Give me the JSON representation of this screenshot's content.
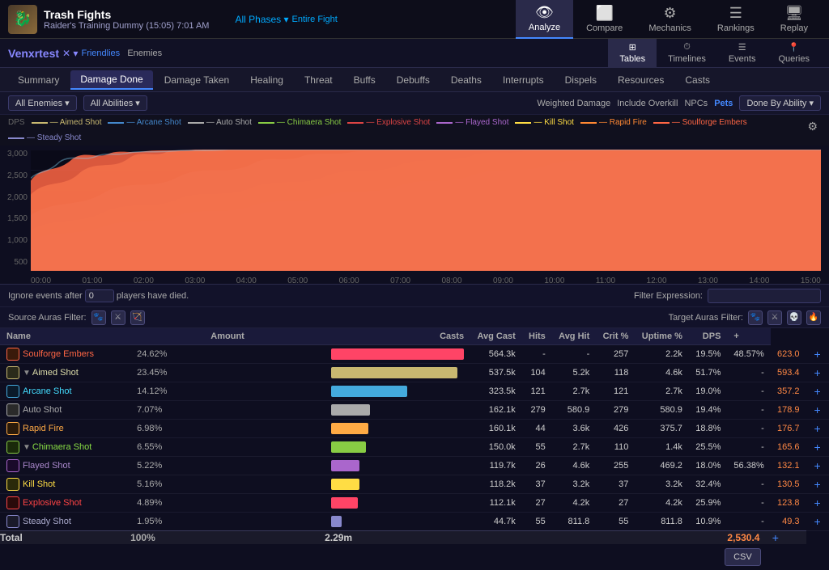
{
  "topNav": {
    "bossIcon": "🐉",
    "bossName": "Trash Fights",
    "bossSub": "Raider's Training Dummy (15:05)  7:01 AM",
    "phasesBtn": "All Phases ▾",
    "entireFight": "Entire Fight",
    "navItems": [
      {
        "label": "Analyze",
        "icon": "👁",
        "active": true
      },
      {
        "label": "Compare",
        "icon": "⬛",
        "active": false
      },
      {
        "label": "Mechanics",
        "icon": "⚙",
        "active": false
      },
      {
        "label": "Rankings",
        "icon": "≡",
        "active": false
      },
      {
        "label": "Replay",
        "icon": "🖥",
        "active": false
      }
    ]
  },
  "secondNav": {
    "playerName": "Venxrtest",
    "playerBadge": "✕",
    "friendlies": "Friendlies",
    "enemies": "Enemies",
    "tabs": [
      {
        "label": "Tables",
        "icon": "⊞",
        "active": true
      },
      {
        "label": "Timelines",
        "icon": "⏱",
        "active": false
      },
      {
        "label": "Events",
        "icon": "☰",
        "active": false
      },
      {
        "label": "Queries",
        "icon": "📍",
        "active": false
      }
    ]
  },
  "tabs": [
    {
      "label": "Summary",
      "active": false
    },
    {
      "label": "Damage Done",
      "active": true
    },
    {
      "label": "Damage Taken",
      "active": false
    },
    {
      "label": "Healing",
      "active": false
    },
    {
      "label": "Threat",
      "active": false
    },
    {
      "label": "Buffs",
      "active": false
    },
    {
      "label": "Debuffs",
      "active": false
    },
    {
      "label": "Deaths",
      "active": false
    },
    {
      "label": "Interrupts",
      "active": false
    },
    {
      "label": "Dispels",
      "active": false
    },
    {
      "label": "Resources",
      "active": false
    },
    {
      "label": "Casts",
      "active": false
    }
  ],
  "filterBar": {
    "enemies": "All Enemies ▾",
    "abilities": "All Abilities ▾",
    "weightedDamage": "Weighted Damage",
    "includeOverkill": "Include Overkill",
    "npcs": "NPCs",
    "pets": "Pets",
    "doneBy": "Done By Ability ▾"
  },
  "legend": [
    {
      "label": "Aimed Shot",
      "color": "#c8b870"
    },
    {
      "label": "Arcane Shot",
      "color": "#4488cc"
    },
    {
      "label": "Auto Shot",
      "color": "#aaaaaa"
    },
    {
      "label": "Chimaera Shot",
      "color": "#88cc44"
    },
    {
      "label": "Explosive Shot",
      "color": "#dd4444"
    },
    {
      "label": "Flayed Shot",
      "color": "#aa66cc"
    },
    {
      "label": "Kill Shot",
      "color": "#ffdd44"
    },
    {
      "label": "Rapid Fire",
      "color": "#ff8833"
    },
    {
      "label": "Soulforge Embers",
      "color": "#ff6644"
    },
    {
      "label": "Steady Shot",
      "color": "#8888cc"
    }
  ],
  "chart": {
    "yLabels": [
      "3,000",
      "2,500",
      "2,000",
      "1,500",
      "1,000",
      "500"
    ],
    "xLabels": [
      "00:00",
      "01:00",
      "02:00",
      "03:00",
      "04:00",
      "05:00",
      "06:00",
      "07:00",
      "08:00",
      "09:00",
      "10:00",
      "11:00",
      "12:00",
      "13:00",
      "14:00",
      "15:00"
    ],
    "yAxisLabel": "DPS"
  },
  "controls": {
    "ignoreText": "Ignore events after",
    "playersText": "players have died.",
    "filterLabel": "Filter Expression:",
    "filterPlaceholder": ""
  },
  "auras": {
    "sourceLabel": "Source Auras Filter:",
    "targetLabel": "Target Auras Filter:"
  },
  "tableHeaders": [
    {
      "label": "Name"
    },
    {
      "label": "Amount",
      "center": true
    },
    {
      "label": "Casts",
      "right": true
    },
    {
      "label": "Avg Cast",
      "right": true
    },
    {
      "label": "Hits",
      "right": true
    },
    {
      "label": "Avg Hit",
      "right": true
    },
    {
      "label": "Crit %",
      "right": true
    },
    {
      "label": "Uptime %",
      "right": true
    },
    {
      "label": "DPS",
      "right": true
    },
    {
      "label": "+"
    }
  ],
  "tableRows": [
    {
      "name": "Soulforge Embers",
      "cls": "soulforge",
      "iconColor": "#ff6644",
      "iconBg": "#3a1a0a",
      "pct": "24.62%",
      "barPct": 100,
      "barColor": "#ff4466",
      "amount": "564.3k",
      "casts": "-",
      "avgCast": "-",
      "hits": "257",
      "avgHit": "2.2k",
      "critPct": "19.5%",
      "uptime": "48.57%",
      "dps": "623.0",
      "hasExpand": false
    },
    {
      "name": "Aimed Shot",
      "cls": "aimed",
      "iconColor": "#c8b870",
      "iconBg": "#2a2a1a",
      "pct": "23.45%",
      "barPct": 95,
      "barColor": "#c8b870",
      "amount": "537.5k",
      "casts": "104",
      "avgCast": "5.2k",
      "hits": "118",
      "avgHit": "4.6k",
      "critPct": "51.7%",
      "uptime": "-",
      "dps": "593.4",
      "hasExpand": true
    },
    {
      "name": "Arcane Shot",
      "cls": "arcane",
      "iconColor": "#44aadd",
      "iconBg": "#0a1a2a",
      "pct": "14.12%",
      "barPct": 57,
      "barColor": "#44aadd",
      "amount": "323.5k",
      "casts": "121",
      "avgCast": "2.7k",
      "hits": "121",
      "avgHit": "2.7k",
      "critPct": "19.0%",
      "uptime": "-",
      "dps": "357.2",
      "hasExpand": false
    },
    {
      "name": "Auto Shot",
      "cls": "auto",
      "iconColor": "#aaaaaa",
      "iconBg": "#2a2a2a",
      "pct": "7.07%",
      "barPct": 29,
      "barColor": "#aaaaaa",
      "amount": "162.1k",
      "casts": "279",
      "avgCast": "580.9",
      "hits": "279",
      "avgHit": "580.9",
      "critPct": "19.4%",
      "uptime": "-",
      "dps": "178.9",
      "hasExpand": false
    },
    {
      "name": "Rapid Fire",
      "cls": "rapid",
      "iconColor": "#ffaa44",
      "iconBg": "#2a1a0a",
      "pct": "6.98%",
      "barPct": 28,
      "barColor": "#ffaa44",
      "amount": "160.1k",
      "casts": "44",
      "avgCast": "3.6k",
      "hits": "426",
      "avgHit": "375.7",
      "critPct": "18.8%",
      "uptime": "-",
      "dps": "176.7",
      "hasExpand": false
    },
    {
      "name": "Chimaera Shot",
      "cls": "chimaera",
      "iconColor": "#88cc44",
      "iconBg": "#1a2a0a",
      "pct": "6.55%",
      "barPct": 26,
      "barColor": "#88cc44",
      "amount": "150.0k",
      "casts": "55",
      "avgCast": "2.7k",
      "hits": "110",
      "avgHit": "1.4k",
      "critPct": "25.5%",
      "uptime": "-",
      "dps": "165.6",
      "hasExpand": true
    },
    {
      "name": "Flayed Shot",
      "cls": "flayed",
      "iconColor": "#aa66cc",
      "iconBg": "#1a0a2a",
      "pct": "5.22%",
      "barPct": 21,
      "barColor": "#aa66cc",
      "amount": "119.7k",
      "casts": "26",
      "avgCast": "4.6k",
      "hits": "255",
      "avgHit": "469.2",
      "critPct": "18.0%",
      "uptime": "56.38%",
      "dps": "132.1",
      "hasExpand": false
    },
    {
      "name": "Kill Shot",
      "cls": "kill",
      "iconColor": "#ffdd44",
      "iconBg": "#2a2a0a",
      "pct": "5.16%",
      "barPct": 21,
      "barColor": "#ffdd44",
      "amount": "118.2k",
      "casts": "37",
      "avgCast": "3.2k",
      "hits": "37",
      "avgHit": "3.2k",
      "critPct": "32.4%",
      "uptime": "-",
      "dps": "130.5",
      "hasExpand": false
    },
    {
      "name": "Explosive Shot",
      "cls": "explosive",
      "iconColor": "#ff4444",
      "iconBg": "#2a0a0a",
      "pct": "4.89%",
      "barPct": 20,
      "barColor": "#ff4466",
      "amount": "112.1k",
      "casts": "27",
      "avgCast": "4.2k",
      "hits": "27",
      "avgHit": "4.2k",
      "critPct": "25.9%",
      "uptime": "-",
      "dps": "123.8",
      "hasExpand": false
    },
    {
      "name": "Steady Shot",
      "cls": "steady",
      "iconColor": "#8888cc",
      "iconBg": "#1a1a2a",
      "pct": "1.95%",
      "barPct": 8,
      "barColor": "#8888cc",
      "amount": "44.7k",
      "casts": "55",
      "avgCast": "811.8",
      "hits": "55",
      "avgHit": "811.8",
      "critPct": "10.9%",
      "uptime": "-",
      "dps": "49.3",
      "hasExpand": false
    }
  ],
  "tableFoot": {
    "label": "Total",
    "pct": "100%",
    "amount": "2.29m",
    "dps": "2,530.4"
  },
  "csvBtn": "CSV"
}
